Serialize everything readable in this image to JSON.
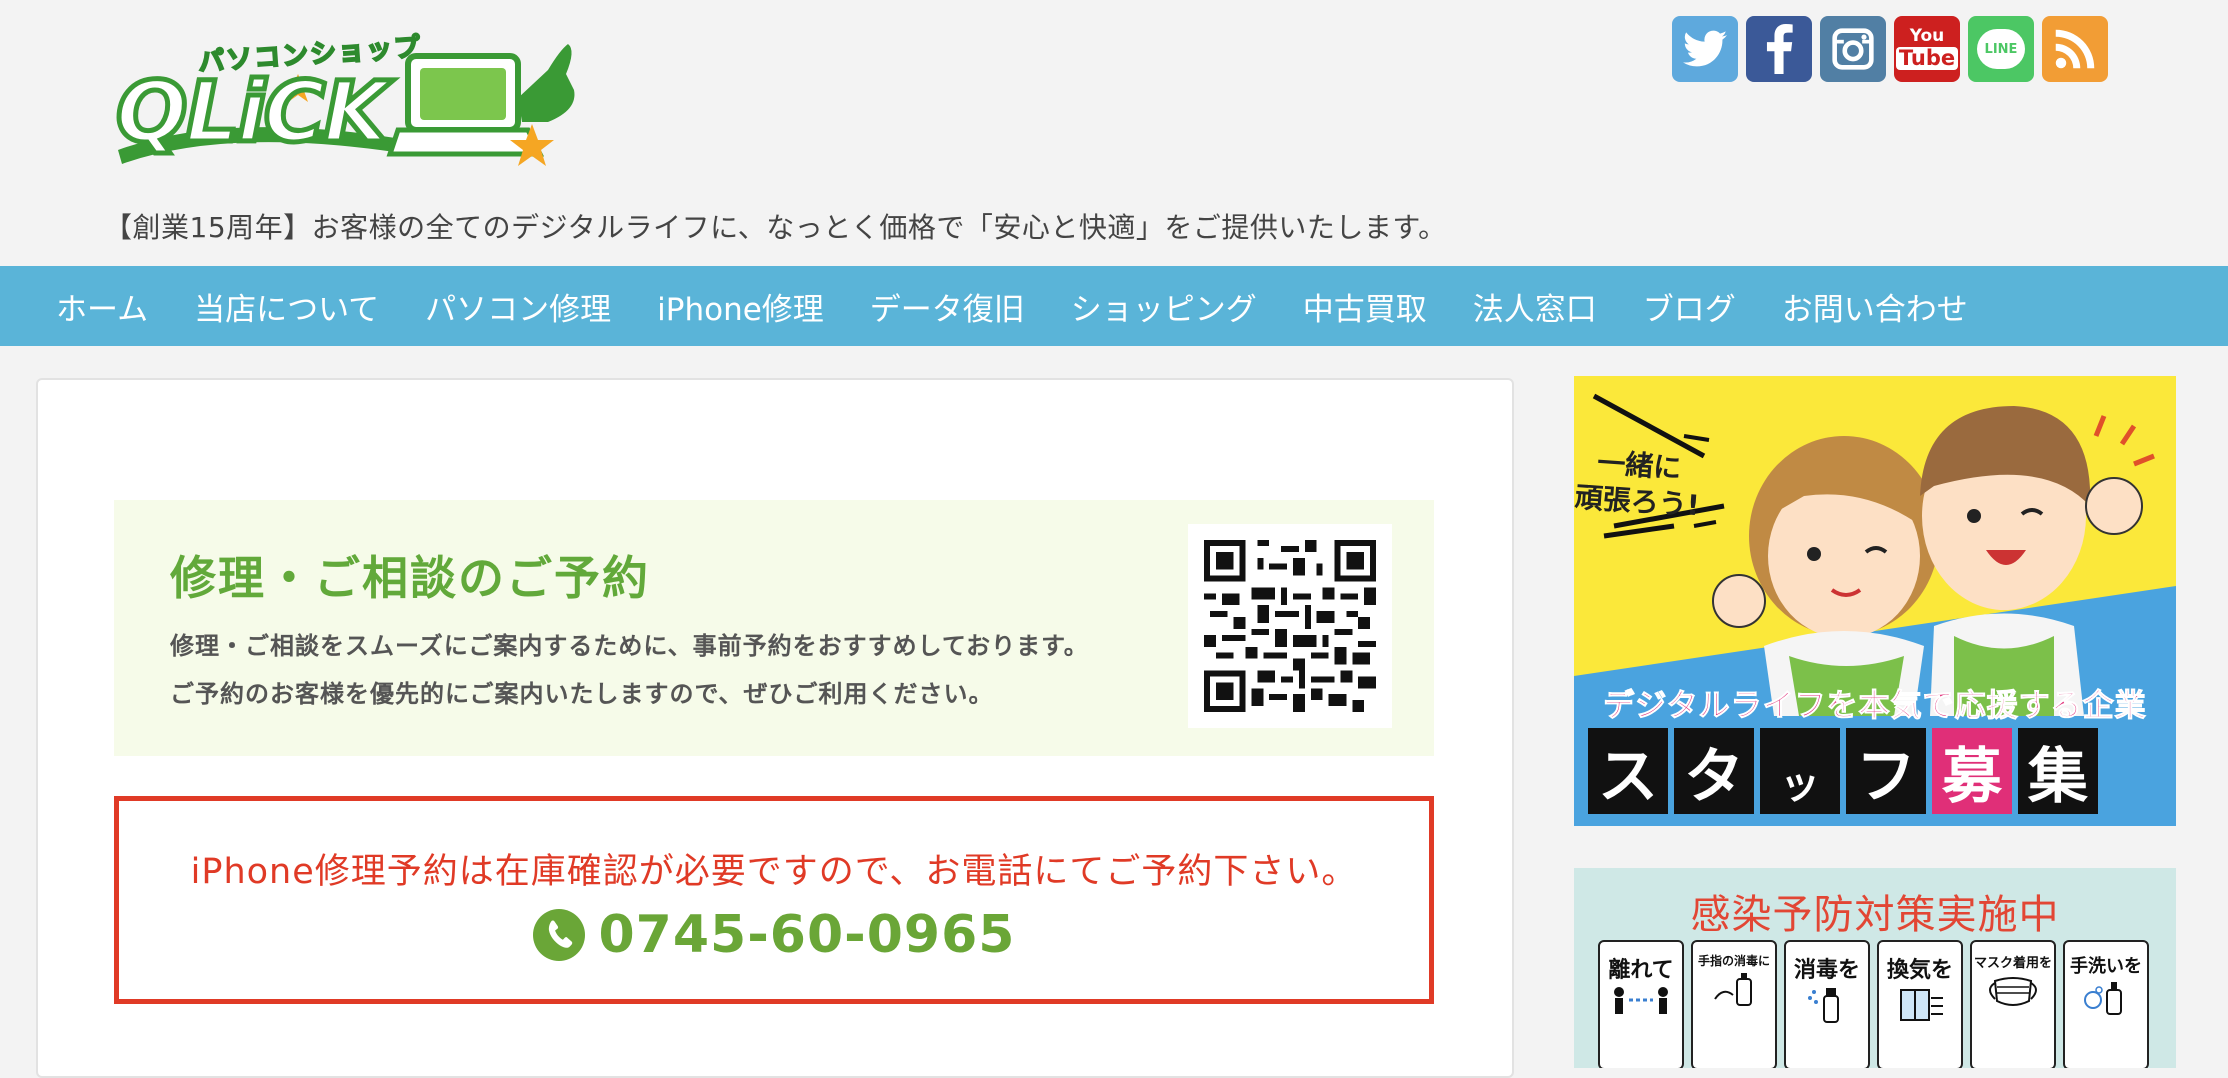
{
  "header": {
    "logo_small": "パソコンショップ",
    "logo_main": "QLiCK",
    "tagline": "【創業15周年】お客様の全てのデジタルライフに、なっとく価格で「安心と快適」をご提供いたします。",
    "social": [
      {
        "name": "twitter-icon",
        "color": "#5ea9dd"
      },
      {
        "name": "facebook-icon",
        "color": "#3b5998"
      },
      {
        "name": "instagram-icon",
        "color": "#517fa4"
      },
      {
        "name": "youtube-icon",
        "color": "#cd201f",
        "line1": "You",
        "line2": "Tube"
      },
      {
        "name": "line-icon",
        "color": "#4cc764",
        "label": "LINE"
      },
      {
        "name": "rss-icon",
        "color": "#f29d35"
      }
    ]
  },
  "nav": {
    "items": [
      "ホーム",
      "当店について",
      "パソコン修理",
      "iPhone修理",
      "データ復旧",
      "ショッピング",
      "中古買取",
      "法人窓口",
      "ブログ",
      "お問い合わせ"
    ]
  },
  "main": {
    "reserve_title": "修理・ご相談のご予約",
    "reserve_line1": "修理・ご相談をスムーズにご案内するために、事前予約をおすすめしております。",
    "reserve_line2": "ご予約のお客様を優先的にご案内いたしますので、ぜひご利用ください。",
    "iphone_note": "iPhone修理予約は在庫確認が必要ですので、お電話にてご予約下さい。",
    "phone": "0745-60-0965"
  },
  "sidebar": {
    "staff_banner": {
      "catch_line1": "一緒に",
      "catch_line2": "頑張ろう!",
      "sub": "デジタルライフを本気で応援する企業",
      "tiles": [
        "ス",
        "タ",
        "ッ",
        "フ",
        "募",
        "集"
      ]
    },
    "covid_banner": {
      "title": "感染予防対策実施中",
      "cards": [
        "離れて",
        "手指の消毒に",
        "消毒を",
        "換気を",
        "マスク着用を",
        "手洗いを"
      ]
    }
  },
  "colors": {
    "nav_bg": "#5ab4d8",
    "accent_green": "#62a93a",
    "alert_red": "#e03a26",
    "staff_pink": "#e02f78"
  }
}
